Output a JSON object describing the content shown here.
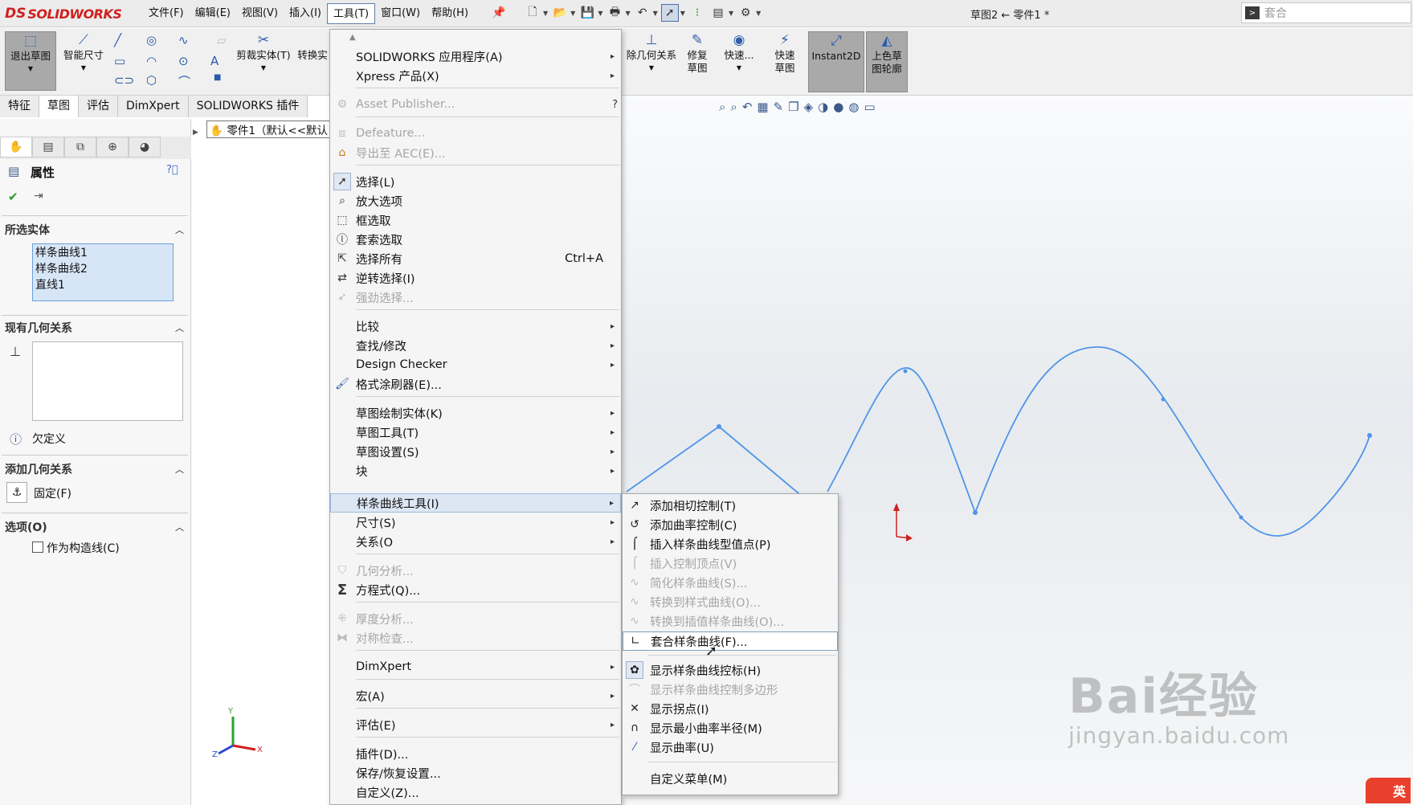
{
  "app": {
    "logo_mark": "DS",
    "logo_text": "SOLIDWORKS",
    "doc_title": "草图2 ← 零件1 *",
    "search_text": "套合"
  },
  "menubar": [
    "文件(F)",
    "编辑(E)",
    "视图(V)",
    "插入(I)",
    "工具(T)",
    "窗口(W)",
    "帮助(H)"
  ],
  "toolbar": {
    "exit_sketch": "退出草图",
    "smart_dim": "智能尺寸",
    "trim": "剪裁实体(T)",
    "convert": "转换实",
    "relations": "除几何关系",
    "repair": "修复草图",
    "quick": "快速...",
    "quick_sketch": "快速草图",
    "instant2d": "Instant2D",
    "shade": "上色草图轮廓"
  },
  "tabs": [
    "特征",
    "草图",
    "评估",
    "DimXpert",
    "SOLIDWORKS 插件"
  ],
  "property": {
    "title": "属性",
    "sel_title": "所选实体",
    "selected": [
      "样条曲线1",
      "样条曲线2",
      "直线1"
    ],
    "exist_title": "现有几何关系",
    "status": "欠定义",
    "add_title": "添加几何关系",
    "fix": "固定(F)",
    "opt_title": "选项(O)",
    "construction": "作为构造线(C)"
  },
  "tree": {
    "item": "零件1（默认<<默认"
  },
  "tools_menu": [
    {
      "label": "SOLIDWORKS 应用程序(A)",
      "arrow": "▸"
    },
    {
      "label": "Xpress 产品(X)",
      "arrow": "▸"
    },
    {
      "label": "Asset Publisher...",
      "shortcut": "?"
    },
    {
      "label": "Defeature..."
    },
    {
      "label": "导出至 AEC(E)..."
    },
    {
      "label": "选择(L)"
    },
    {
      "label": "放大选项"
    },
    {
      "label": "框选取"
    },
    {
      "label": "套索选取"
    },
    {
      "label": "选择所有",
      "shortcut": "Ctrl+A"
    },
    {
      "label": "逆转选择(I)"
    },
    {
      "label": "强劲选择..."
    },
    {
      "label": "比较",
      "arrow": "▸"
    },
    {
      "label": "查找/修改",
      "arrow": "▸"
    },
    {
      "label": "Design Checker",
      "arrow": "▸"
    },
    {
      "label": "格式涂刷器(E)..."
    },
    {
      "label": "草图绘制实体(K)",
      "arrow": "▸"
    },
    {
      "label": "草图工具(T)",
      "arrow": "▸"
    },
    {
      "label": "草图设置(S)",
      "arrow": "▸"
    },
    {
      "label": "块",
      "arrow": "▸"
    },
    {
      "label": "样条曲线工具(I)",
      "arrow": "▸"
    },
    {
      "label": "尺寸(S)",
      "arrow": "▸"
    },
    {
      "label": "关系(O",
      "arrow": "▸"
    },
    {
      "label": "几何分析..."
    },
    {
      "label": "方程式(Q)..."
    },
    {
      "label": "厚度分析..."
    },
    {
      "label": "对称检查..."
    },
    {
      "label": "DimXpert",
      "arrow": "▸"
    },
    {
      "label": "宏(A)",
      "arrow": "▸"
    },
    {
      "label": "评估(E)",
      "arrow": "▸"
    },
    {
      "label": "插件(D)..."
    },
    {
      "label": "保存/恢复设置..."
    },
    {
      "label": "自定义(Z)..."
    }
  ],
  "spline_submenu": [
    {
      "label": "添加相切控制(T)"
    },
    {
      "label": "添加曲率控制(C)"
    },
    {
      "label": "插入样条曲线型值点(P)"
    },
    {
      "label": "插入控制顶点(V)"
    },
    {
      "label": "简化样条曲线(S)..."
    },
    {
      "label": "转换到样式曲线(O)..."
    },
    {
      "label": "转换到插值样条曲线(O)..."
    },
    {
      "label": "套合样条曲线(F)..."
    },
    {
      "label": "显示样条曲线控标(H)"
    },
    {
      "label": "显示样条曲线控制多边形"
    },
    {
      "label": "显示拐点(I)"
    },
    {
      "label": "显示最小曲率半径(M)"
    },
    {
      "label": "显示曲率(U)"
    },
    {
      "label": "自定义菜单(M)"
    }
  ],
  "triad": {
    "x": "X",
    "y": "Y",
    "z": "Z"
  },
  "watermark": {
    "big": "Bai经验",
    "url": "jingyan.baidu.com"
  },
  "ime": "英",
  "colors": {
    "spline": "#4f95e8",
    "accent": "#d02020",
    "selection": "#d7e6f7"
  }
}
